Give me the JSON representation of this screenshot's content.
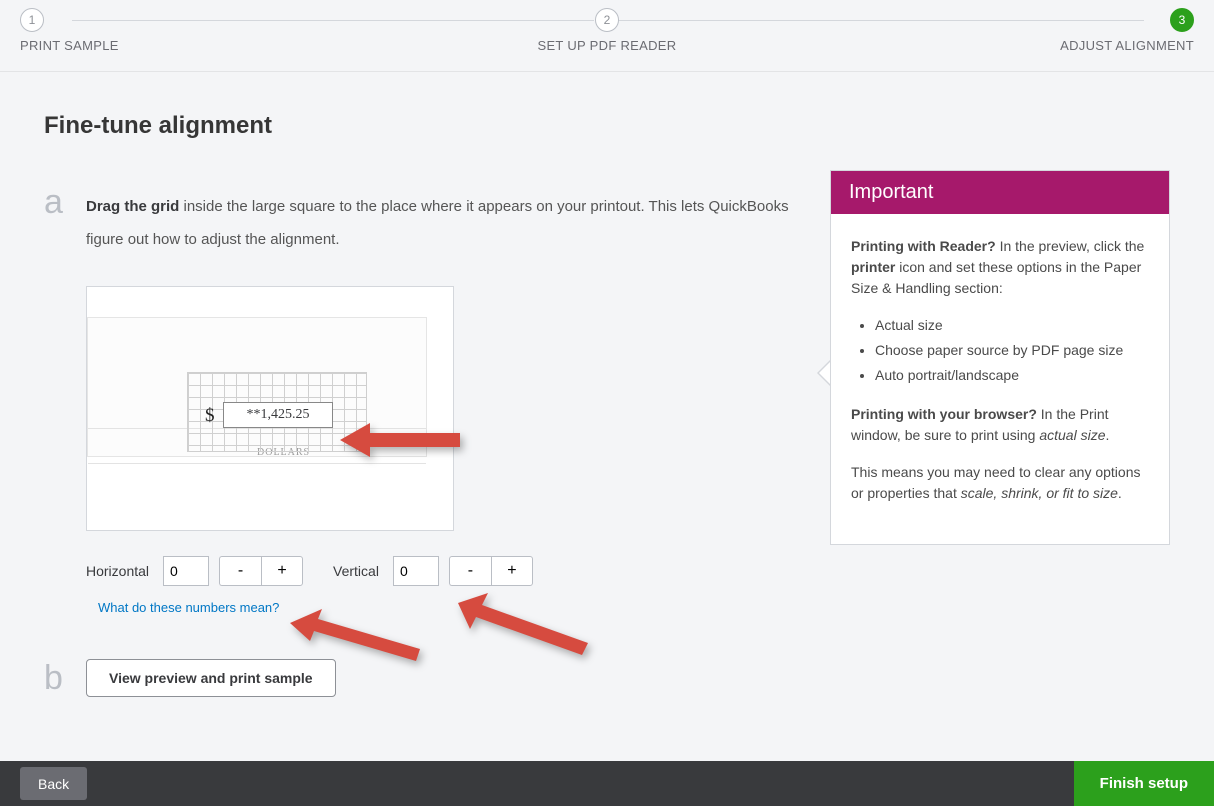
{
  "stepper": {
    "steps": [
      {
        "num": "1",
        "label": "PRINT SAMPLE"
      },
      {
        "num": "2",
        "label": "SET UP PDF READER"
      },
      {
        "num": "3",
        "label": "ADJUST ALIGNMENT"
      }
    ]
  },
  "page": {
    "title": "Fine-tune alignment",
    "section_a_letter": "a",
    "section_a_bold": "Drag the grid",
    "section_a_rest": " inside the large square to the place where it appears on your printout. This lets QuickBooks figure out how to adjust the alignment.",
    "section_b_letter": "b"
  },
  "preview": {
    "dollar": "$",
    "amount": "**1,425.25",
    "dollars_caption": "DOLLARS"
  },
  "controls": {
    "horizontal_label": "Horizontal",
    "horizontal_value": "0",
    "vertical_label": "Vertical",
    "vertical_value": "0",
    "minus": "-",
    "plus": "+",
    "help_link": "What do these numbers mean?"
  },
  "buttons": {
    "preview_print": "View preview and print sample",
    "back": "Back",
    "finish": "Finish setup"
  },
  "panel": {
    "title": "Important",
    "p1_a": "Printing with Reader?",
    "p1_b": " In the preview, click the ",
    "p1_c": "printer",
    "p1_d": " icon and set these options in the Paper Size & Handling section:",
    "bullets": [
      "Actual size",
      "Choose paper source by PDF page size",
      "Auto portrait/landscape"
    ],
    "p2_a": "Printing with your browser?",
    "p2_b": " In the Print window, be sure to print using ",
    "p2_c": "actual size",
    "p2_d": ".",
    "p3_a": "This means you may need to clear any options or properties that ",
    "p3_b": "scale, shrink, or fit to size",
    "p3_c": "."
  }
}
